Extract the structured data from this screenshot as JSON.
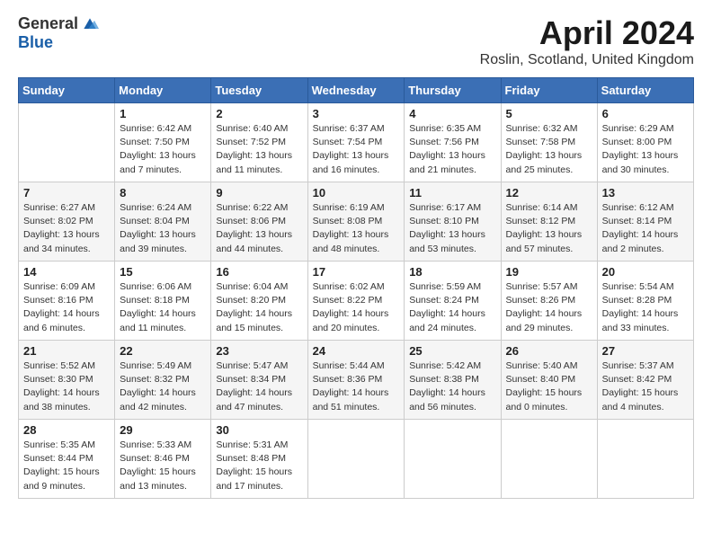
{
  "header": {
    "logo_general": "General",
    "logo_blue": "Blue",
    "title": "April 2024",
    "location": "Roslin, Scotland, United Kingdom"
  },
  "weekdays": [
    "Sunday",
    "Monday",
    "Tuesday",
    "Wednesday",
    "Thursday",
    "Friday",
    "Saturday"
  ],
  "weeks": [
    [
      null,
      {
        "day": 1,
        "sunrise": "6:42 AM",
        "sunset": "7:50 PM",
        "daylight": "13 hours and 7 minutes."
      },
      {
        "day": 2,
        "sunrise": "6:40 AM",
        "sunset": "7:52 PM",
        "daylight": "13 hours and 11 minutes."
      },
      {
        "day": 3,
        "sunrise": "6:37 AM",
        "sunset": "7:54 PM",
        "daylight": "13 hours and 16 minutes."
      },
      {
        "day": 4,
        "sunrise": "6:35 AM",
        "sunset": "7:56 PM",
        "daylight": "13 hours and 21 minutes."
      },
      {
        "day": 5,
        "sunrise": "6:32 AM",
        "sunset": "7:58 PM",
        "daylight": "13 hours and 25 minutes."
      },
      {
        "day": 6,
        "sunrise": "6:29 AM",
        "sunset": "8:00 PM",
        "daylight": "13 hours and 30 minutes."
      }
    ],
    [
      {
        "day": 7,
        "sunrise": "6:27 AM",
        "sunset": "8:02 PM",
        "daylight": "13 hours and 34 minutes."
      },
      {
        "day": 8,
        "sunrise": "6:24 AM",
        "sunset": "8:04 PM",
        "daylight": "13 hours and 39 minutes."
      },
      {
        "day": 9,
        "sunrise": "6:22 AM",
        "sunset": "8:06 PM",
        "daylight": "13 hours and 44 minutes."
      },
      {
        "day": 10,
        "sunrise": "6:19 AM",
        "sunset": "8:08 PM",
        "daylight": "13 hours and 48 minutes."
      },
      {
        "day": 11,
        "sunrise": "6:17 AM",
        "sunset": "8:10 PM",
        "daylight": "13 hours and 53 minutes."
      },
      {
        "day": 12,
        "sunrise": "6:14 AM",
        "sunset": "8:12 PM",
        "daylight": "13 hours and 57 minutes."
      },
      {
        "day": 13,
        "sunrise": "6:12 AM",
        "sunset": "8:14 PM",
        "daylight": "14 hours and 2 minutes."
      }
    ],
    [
      {
        "day": 14,
        "sunrise": "6:09 AM",
        "sunset": "8:16 PM",
        "daylight": "14 hours and 6 minutes."
      },
      {
        "day": 15,
        "sunrise": "6:06 AM",
        "sunset": "8:18 PM",
        "daylight": "14 hours and 11 minutes."
      },
      {
        "day": 16,
        "sunrise": "6:04 AM",
        "sunset": "8:20 PM",
        "daylight": "14 hours and 15 minutes."
      },
      {
        "day": 17,
        "sunrise": "6:02 AM",
        "sunset": "8:22 PM",
        "daylight": "14 hours and 20 minutes."
      },
      {
        "day": 18,
        "sunrise": "5:59 AM",
        "sunset": "8:24 PM",
        "daylight": "14 hours and 24 minutes."
      },
      {
        "day": 19,
        "sunrise": "5:57 AM",
        "sunset": "8:26 PM",
        "daylight": "14 hours and 29 minutes."
      },
      {
        "day": 20,
        "sunrise": "5:54 AM",
        "sunset": "8:28 PM",
        "daylight": "14 hours and 33 minutes."
      }
    ],
    [
      {
        "day": 21,
        "sunrise": "5:52 AM",
        "sunset": "8:30 PM",
        "daylight": "14 hours and 38 minutes."
      },
      {
        "day": 22,
        "sunrise": "5:49 AM",
        "sunset": "8:32 PM",
        "daylight": "14 hours and 42 minutes."
      },
      {
        "day": 23,
        "sunrise": "5:47 AM",
        "sunset": "8:34 PM",
        "daylight": "14 hours and 47 minutes."
      },
      {
        "day": 24,
        "sunrise": "5:44 AM",
        "sunset": "8:36 PM",
        "daylight": "14 hours and 51 minutes."
      },
      {
        "day": 25,
        "sunrise": "5:42 AM",
        "sunset": "8:38 PM",
        "daylight": "14 hours and 56 minutes."
      },
      {
        "day": 26,
        "sunrise": "5:40 AM",
        "sunset": "8:40 PM",
        "daylight": "15 hours and 0 minutes."
      },
      {
        "day": 27,
        "sunrise": "5:37 AM",
        "sunset": "8:42 PM",
        "daylight": "15 hours and 4 minutes."
      }
    ],
    [
      {
        "day": 28,
        "sunrise": "5:35 AM",
        "sunset": "8:44 PM",
        "daylight": "15 hours and 9 minutes."
      },
      {
        "day": 29,
        "sunrise": "5:33 AM",
        "sunset": "8:46 PM",
        "daylight": "15 hours and 13 minutes."
      },
      {
        "day": 30,
        "sunrise": "5:31 AM",
        "sunset": "8:48 PM",
        "daylight": "15 hours and 17 minutes."
      },
      null,
      null,
      null,
      null
    ]
  ]
}
